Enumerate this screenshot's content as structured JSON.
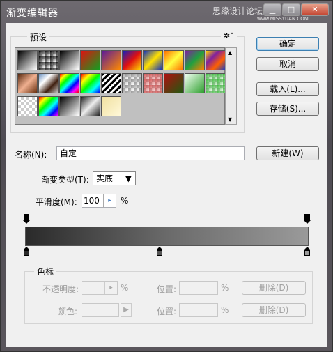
{
  "window": {
    "title": "渐变编辑器",
    "watermark": "思缘设计论坛",
    "watermark_url": "www.MISSYUAN.COM"
  },
  "presets": {
    "label": "预设",
    "menu_icon": "gear-icon",
    "swatches": [
      {
        "name": "foreground-to-background",
        "css": "linear-gradient(135deg,#000,#fff)"
      },
      {
        "name": "foreground-to-transparent",
        "css": "linear-gradient(135deg,#000,rgba(0,0,0,0))"
      },
      {
        "name": "black-white",
        "css": "linear-gradient(135deg,#000,#fff)"
      },
      {
        "name": "red-green",
        "css": "linear-gradient(135deg,#e01010,#10a020)"
      },
      {
        "name": "violet-orange",
        "css": "linear-gradient(135deg,#5a1a9a,#ff8a00)"
      },
      {
        "name": "blue-red-yellow",
        "css": "linear-gradient(135deg,#1020c0,#e01010,#ffe000)"
      },
      {
        "name": "blue-yellow-blue",
        "css": "linear-gradient(135deg,#1030c0,#ffe000,#1030c0)"
      },
      {
        "name": "orange-yellow-orange",
        "css": "linear-gradient(135deg,#ff7000,#ffff40,#ff7000)"
      },
      {
        "name": "violet-green-orange",
        "css": "linear-gradient(135deg,#8020a0,#20a040,#ff8000)"
      },
      {
        "name": "yellow-violet-orange-blue",
        "css": "linear-gradient(135deg,#ffd000,#8020a0,#ff6000,#2040c0)"
      },
      {
        "name": "copper",
        "css": "linear-gradient(135deg,#5a2a10,#f0b090,#6a3010)"
      },
      {
        "name": "chrome",
        "css": "linear-gradient(135deg,#6a90c0,#fff,#402010,#c0c0c0)"
      },
      {
        "name": "spectrum",
        "css": "linear-gradient(135deg,#f00,#ff0,#0f0,#0ff,#00f,#f0f,#f00)"
      },
      {
        "name": "transparent-rainbow",
        "css": "linear-gradient(135deg,#f00,#ff0,#0f0,#0ff,#00f)"
      },
      {
        "name": "transparent-stripes",
        "css": "repeating-linear-gradient(135deg,#000 0 3px,#fff 3px 6px)"
      },
      {
        "name": "neutral-density",
        "css": "linear-gradient(135deg,rgba(0,0,0,0.35),rgba(0,0,0,0))"
      },
      {
        "name": "red-transparent",
        "css": "linear-gradient(135deg,rgba(200,40,40,0.8),rgba(200,40,40,0.2))"
      },
      {
        "name": "dark-red-green",
        "css": "linear-gradient(135deg,#b01010,#205a10)"
      },
      {
        "name": "white-green",
        "css": "linear-gradient(135deg,#f0fff0,#30a030)"
      },
      {
        "name": "green-transparent",
        "css": "linear-gradient(135deg,rgba(40,180,40,0.9),rgba(40,180,40,0.1))"
      },
      {
        "name": "checker-1",
        "css": ""
      },
      {
        "name": "rainbow-2",
        "css": "linear-gradient(135deg,#f00,#ff0,#0f0,#0ff,#00f,#f0f)"
      },
      {
        "name": "black-white-2",
        "css": "linear-gradient(135deg,#000,#fff)"
      },
      {
        "name": "silver",
        "css": "linear-gradient(135deg,#222,#eee,#222)"
      },
      {
        "name": "cream",
        "css": "linear-gradient(135deg,#f0e0a0,#fff8d8)"
      }
    ]
  },
  "buttons": {
    "ok": "确定",
    "cancel": "取消",
    "load": "载入(L)...",
    "save": "存储(S)...",
    "new": "新建(W)"
  },
  "name_field": {
    "label": "名称(N):",
    "value": "自定"
  },
  "gradient": {
    "type_label": "渐变类型(T):",
    "type_value": "实底",
    "smoothness_label": "平滑度(M):",
    "smoothness_value": "100",
    "smoothness_unit": "%",
    "bar_colors": [
      "#2a2a2a",
      "#6a6a6a",
      "#9a9a9a"
    ]
  },
  "stops": {
    "legend": "色标",
    "opacity_label": "不透明度:",
    "opacity_unit": "%",
    "location_label": "位置:",
    "location_unit": "%",
    "delete_label": "删除(D)",
    "color_label": "颜色:"
  }
}
